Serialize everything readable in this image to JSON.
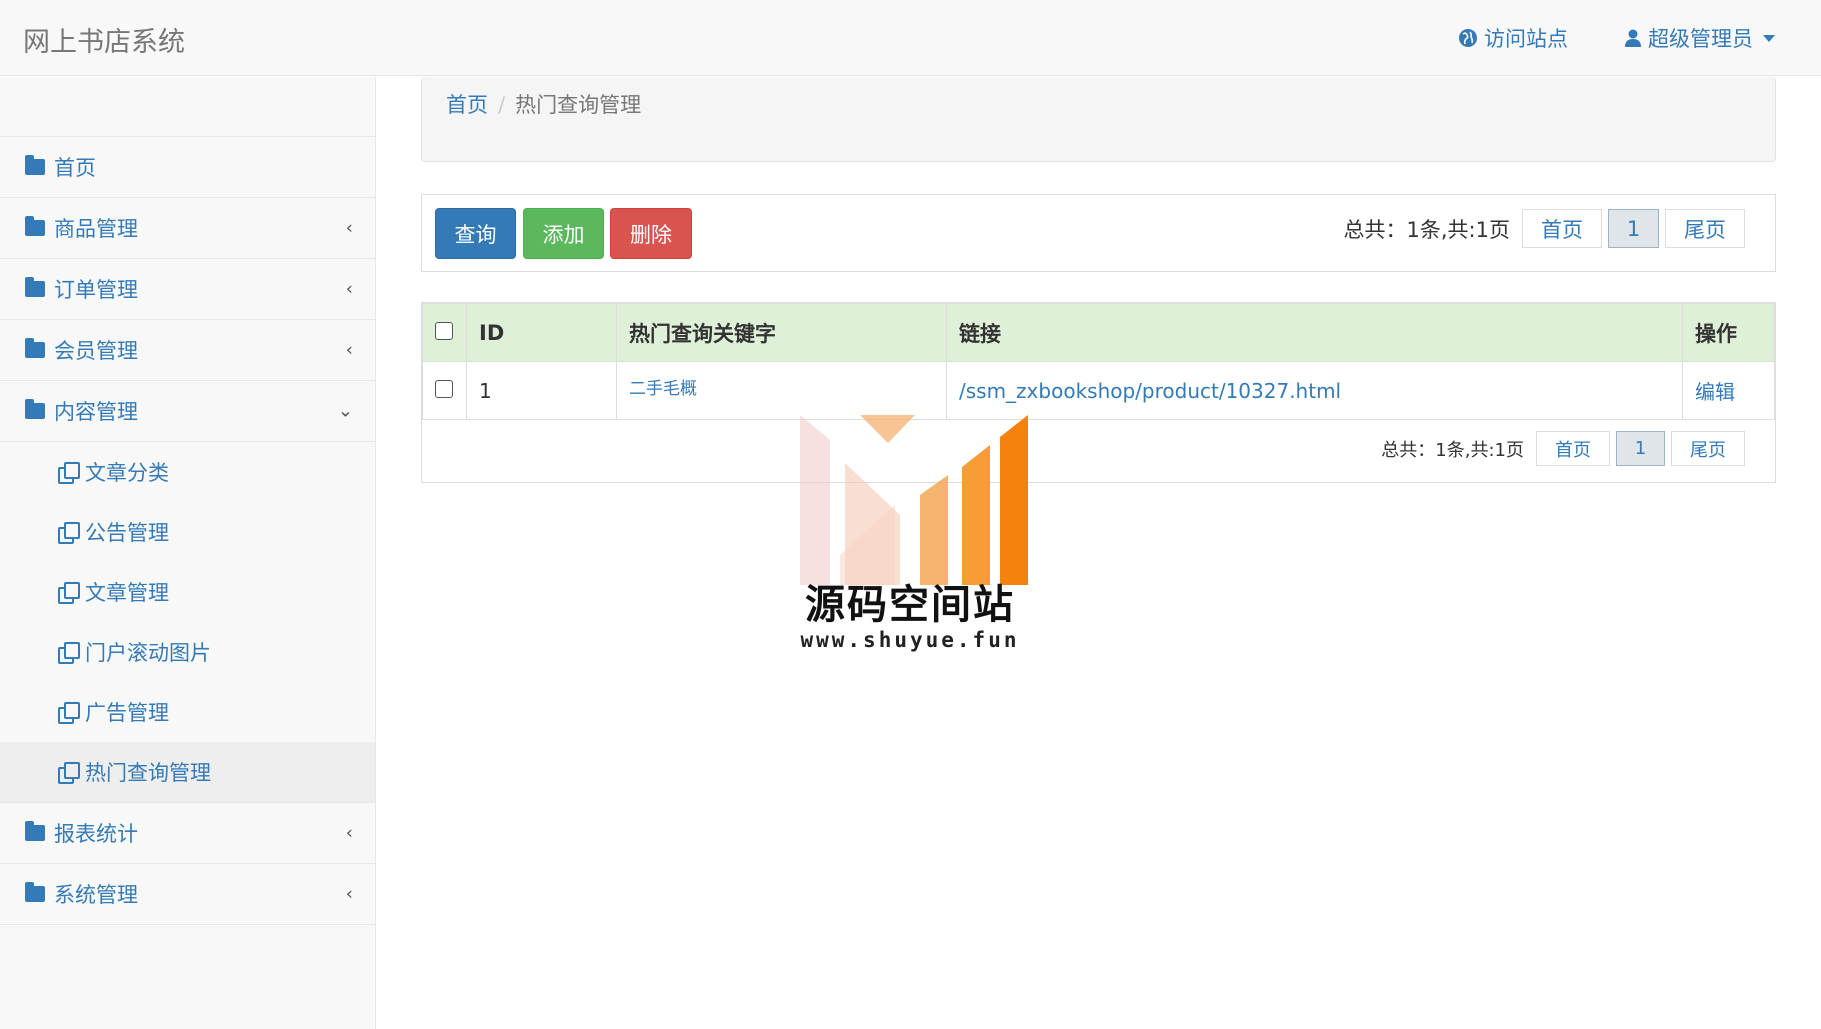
{
  "app": {
    "brand": "网上书店系统",
    "visit_site": "访问站点",
    "admin_user": "超级管理员"
  },
  "sidebar": {
    "items": [
      {
        "label": "首页",
        "has_chevron": false
      },
      {
        "label": "商品管理",
        "chevron": "‹"
      },
      {
        "label": "订单管理",
        "chevron": "‹"
      },
      {
        "label": "会员管理",
        "chevron": "‹"
      },
      {
        "label": "内容管理",
        "chevron": "⌄"
      },
      {
        "label": "报表统计",
        "chevron": "‹"
      },
      {
        "label": "系统管理",
        "chevron": "‹"
      }
    ],
    "content_sub": [
      {
        "label": "文章分类"
      },
      {
        "label": "公告管理"
      },
      {
        "label": "文章管理"
      },
      {
        "label": "门户滚动图片"
      },
      {
        "label": "广告管理"
      },
      {
        "label": "热门查询管理",
        "active": true
      }
    ]
  },
  "breadcrumb": {
    "home": "首页",
    "separator": "/",
    "current": "热门查询管理"
  },
  "toolbar": {
    "query_label": "查询",
    "add_label": "添加",
    "delete_label": "删除"
  },
  "pager": {
    "total_text": "总共：1条,共:1页",
    "first": "首页",
    "current_page": "1",
    "last": "尾页"
  },
  "table": {
    "headers": [
      "ID",
      "热门查询关键字",
      "链接",
      "操作"
    ],
    "rows": [
      {
        "id": "1",
        "keyword": "二手毛概",
        "link": "/ssm_zxbookshop/product/10327.html",
        "action": "编辑"
      }
    ]
  },
  "watermark": {
    "title": "源码空间站",
    "url": "www.shuyue.fun"
  },
  "colors": {
    "primary": "#337ab7",
    "success": "#5cb85c",
    "danger": "#d9534f",
    "header_green": "#dff0d8",
    "watermark_orange": "#f5820d"
  }
}
